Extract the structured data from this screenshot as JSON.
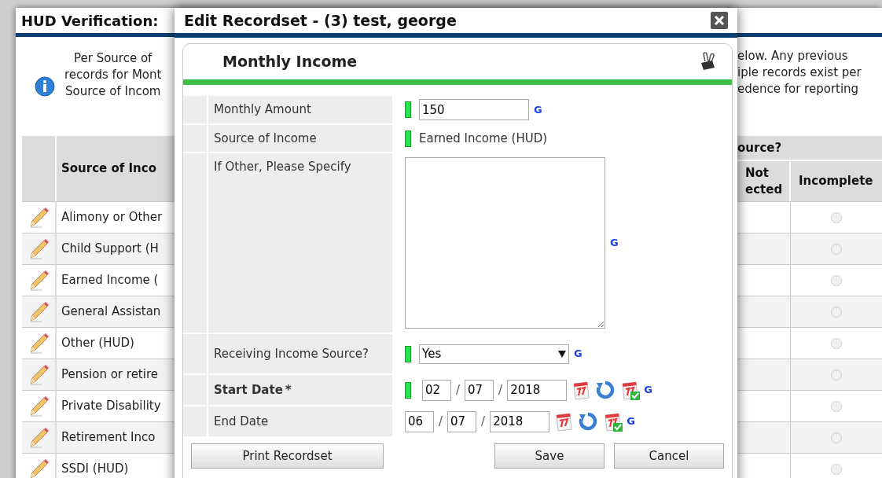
{
  "page": {
    "title": "HUD Verification:",
    "intro_left": [
      "Per Source of",
      "records for Mont",
      "Source of Incom"
    ],
    "intro_right": [
      "elow. Any previous",
      "iple records exist per",
      "edence for reporting"
    ],
    "table": {
      "column_left": "Source of Inco",
      "group_header": "ource?",
      "columns_right": [
        "Not ected",
        "Incomplete"
      ],
      "rows": [
        {
          "source": "Alimony or Other",
          "incomplete_selected": false
        },
        {
          "source": "Child Support (H",
          "incomplete_selected": false
        },
        {
          "source": "Earned Income (",
          "incomplete_selected": false
        },
        {
          "source": "General Assistan",
          "incomplete_selected": false
        },
        {
          "source": "Other (HUD)",
          "incomplete_selected": false
        },
        {
          "source": "Pension or retire",
          "incomplete_selected": false
        },
        {
          "source": "Private Disability",
          "incomplete_selected": false
        },
        {
          "source": "Retirement Inco",
          "incomplete_selected": false
        },
        {
          "source": "SSDI (HUD)",
          "incomplete_selected": false
        }
      ]
    }
  },
  "dialog": {
    "title": "Edit Recordset - (3) test, george",
    "panel_title": "Monthly Income",
    "fields": [
      {
        "kind": "text",
        "label": "Monthly Amount",
        "required": true,
        "value": "150",
        "g": "G"
      },
      {
        "kind": "static",
        "label": "Source of Income",
        "required": true,
        "value": "Earned Income (HUD)"
      },
      {
        "kind": "textarea",
        "label": "If Other, Please Specify",
        "required": false,
        "g": "G"
      },
      {
        "kind": "select",
        "label": "Receiving Income Source?",
        "required": true,
        "value": "Yes",
        "g": "G"
      },
      {
        "kind": "date",
        "label": "Start Date",
        "asterisk": "*",
        "bold": true,
        "required": true,
        "month": "02",
        "day": "07",
        "year": "2018",
        "separators": [
          "/",
          "/"
        ],
        "g": "G"
      },
      {
        "kind": "date",
        "label": "End Date",
        "bold": false,
        "required": false,
        "month": "06",
        "day": "07",
        "year": "2018",
        "separators": [
          "/",
          "/"
        ],
        "g": "G"
      }
    ],
    "buttons": [
      {
        "label": "Print Recordset"
      },
      {
        "label": "Save"
      },
      {
        "label": "Cancel"
      }
    ]
  }
}
